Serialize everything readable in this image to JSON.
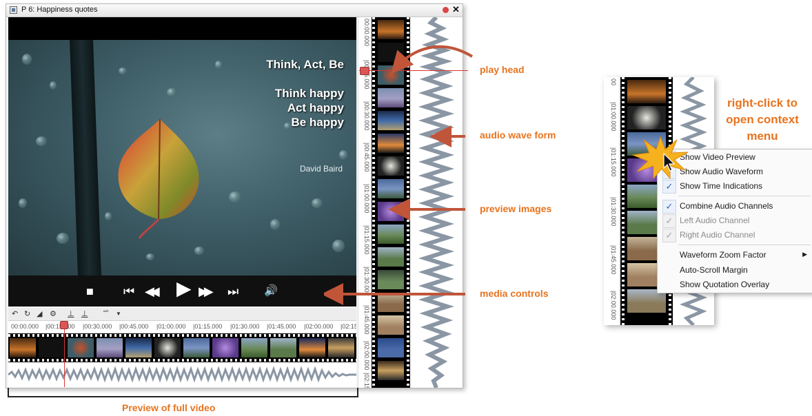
{
  "window": {
    "title": "P 6: Happiness quotes"
  },
  "video": {
    "quote_line1": "Think, Act, Be",
    "quote_line2": "Think happy",
    "quote_line3": "Act happy",
    "quote_line4": "Be happy",
    "author": "David Baird"
  },
  "controls": {
    "stop": "■",
    "prev": "⏮",
    "rewind": "◀◀",
    "play": "▶",
    "forward": "▶▶",
    "next": "⏭",
    "volume": "🔊"
  },
  "toolbar": {
    "quote_label": "“”"
  },
  "timeline": {
    "ruler_labels": [
      "00:00.000",
      "|00:15.000",
      "|00:30.000",
      "|00:45.000",
      "|01:00.000",
      "|01:15.000",
      "|01:30.000",
      "|01:45.000",
      "|02:00.000",
      "|02:15"
    ],
    "play_position": "00:15.000"
  },
  "vertical_ruler": {
    "labels": [
      "00:00.000",
      "|00:15.000",
      "|00:30.000",
      "|00:45.000",
      "|01:00.000",
      "|01:15.000",
      "|01:30.000",
      "|01:45.000",
      "|02:00.000",
      "|02:15"
    ]
  },
  "annotations": {
    "play_head": "play head",
    "audio_wave_form": "audio wave form",
    "preview_images": "preview images",
    "media_controls": "media controls",
    "preview_full_video": "Preview of full video",
    "context_note_1": "right-click to",
    "context_note_2": "open context",
    "context_note_3": "menu"
  },
  "inset_ruler": {
    "labels": [
      "00",
      "|01:00.000",
      "|01:15.000",
      "|01:30.000",
      "|01:45.000",
      "|02:00.000"
    ]
  },
  "context_menu": {
    "items": [
      {
        "label": "Show Video Preview",
        "checked": true,
        "enabled": true
      },
      {
        "label": "Show Audio Waveform",
        "checked": true,
        "enabled": true
      },
      {
        "label": "Show Time Indications",
        "checked": true,
        "enabled": true
      },
      {
        "label": "Combine Audio Channels",
        "checked": true,
        "enabled": true
      },
      {
        "label": "Left Audio Channel",
        "checked": true,
        "enabled": false
      },
      {
        "label": "Right Audio Channel",
        "checked": true,
        "enabled": false
      },
      {
        "label": "Waveform Zoom Factor",
        "checked": false,
        "enabled": true,
        "submenu": true
      },
      {
        "label": "Auto-Scroll Margin",
        "checked": false,
        "enabled": true
      },
      {
        "label": "Show Quotation Overlay",
        "checked": false,
        "enabled": true
      }
    ]
  },
  "colors": {
    "annotation": "#e8731e",
    "check": "#2b63c4",
    "playhead": "#dd3333"
  }
}
